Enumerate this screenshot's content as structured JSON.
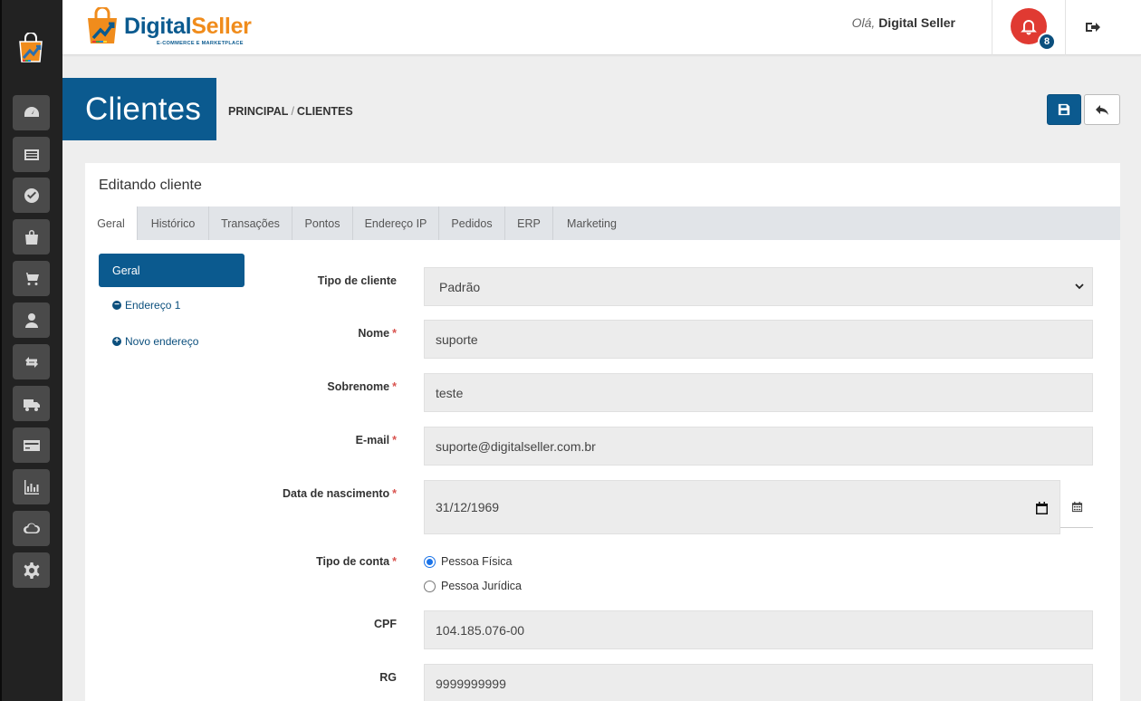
{
  "header": {
    "brand_part1": "Digital",
    "brand_part2": "Seller",
    "brand_tagline": "E-COMMERCE E MARKETPLACE",
    "greeting_prefix": "Olá,",
    "user_name": "Digital Seller",
    "notification_count": "8"
  },
  "sidebar": {
    "items": [
      {
        "icon": "dashboard-icon"
      },
      {
        "icon": "catalog-icon"
      },
      {
        "icon": "check-circle-icon"
      },
      {
        "icon": "shopping-bag-icon"
      },
      {
        "icon": "cart-icon"
      },
      {
        "icon": "user-icon"
      },
      {
        "icon": "exchange-icon"
      },
      {
        "icon": "truck-icon"
      },
      {
        "icon": "credit-card-icon"
      },
      {
        "icon": "reports-icon"
      },
      {
        "icon": "cloud-icon"
      },
      {
        "icon": "settings-icon"
      }
    ]
  },
  "page": {
    "title": "Clientes",
    "breadcrumb_root": "PRINCIPAL",
    "breadcrumb_sep": "/",
    "breadcrumb_current": "CLIENTES"
  },
  "card": {
    "title": "Editando cliente",
    "tabs": [
      "Geral",
      "Histórico",
      "Transações",
      "Pontos",
      "Endereço IP",
      "Pedidos",
      "ERP",
      "Marketing"
    ],
    "active_tab": "Geral"
  },
  "subnav": {
    "active": "Geral",
    "address1": "Endereço 1",
    "new_address": "Novo endereço"
  },
  "form": {
    "customer_type_label": "Tipo de cliente",
    "customer_type_value": "Padrão",
    "first_name_label": "Nome",
    "first_name_value": "suporte",
    "last_name_label": "Sobrenome",
    "last_name_value": "teste",
    "email_label": "E-mail",
    "email_value": "suporte@digitalseller.com.br",
    "birthdate_label": "Data de nascimento",
    "birthdate_value": "31/12/1969",
    "account_type_label": "Tipo de conta",
    "account_type_options": [
      "Pessoa Física",
      "Pessoa Jurídica"
    ],
    "account_type_selected": "Pessoa Física",
    "cpf_label": "CPF",
    "cpf_value": "104.185.076-00",
    "rg_label": "RG",
    "rg_value": "9999999999",
    "required_mark": "*"
  },
  "colors": {
    "primary": "#0b5a8f",
    "sidebar": "#222222",
    "notification": "#e03a32",
    "brand_orange": "#f08c1c"
  }
}
